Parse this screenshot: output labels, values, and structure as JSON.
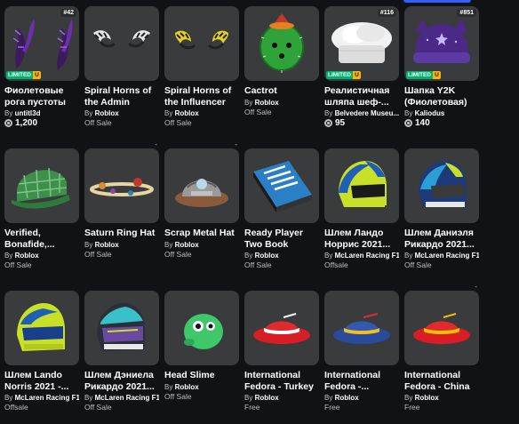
{
  "items": [
    {
      "name": "Фиолетовые рога пустоты",
      "creator_prefix": "By",
      "creator": "untitl3d",
      "price": "1,200",
      "price_type": "robux",
      "serial": "#42",
      "limited": true
    },
    {
      "name": "Spiral Horns of the Admin",
      "creator_prefix": "By",
      "creator": "Roblox",
      "price": "Off Sale",
      "price_type": "text",
      "dash": "-"
    },
    {
      "name": "Spiral Horns of the Influencer",
      "creator_prefix": "By",
      "creator": "Roblox",
      "price": "Off Sale",
      "price_type": "text",
      "dash": "-"
    },
    {
      "name": "Cactrot",
      "creator_prefix": "By",
      "creator": "Roblox",
      "price": "Off Sale",
      "price_type": "text"
    },
    {
      "name": "Реалистичная шляпа шеф-...",
      "creator_prefix": "By",
      "creator": "Belvedere Museu...",
      "price": "95",
      "price_type": "robux",
      "serial": "#116",
      "limited": true
    },
    {
      "name": "Шапка Y2K (Фиолетовая)",
      "creator_prefix": "By",
      "creator": "Kaliodus",
      "price": "140",
      "price_type": "robux",
      "serial": "#851",
      "limited": true
    },
    {
      "name": "Verified, Bonafide,...",
      "creator_prefix": "By",
      "creator": "Roblox",
      "price": "Off Sale",
      "price_type": "text"
    },
    {
      "name": "Saturn Ring Hat",
      "creator_prefix": "By",
      "creator": "Roblox",
      "price": "Off Sale",
      "price_type": "text"
    },
    {
      "name": "Scrap Metal Hat",
      "creator_prefix": "By",
      "creator": "Roblox",
      "price": "Off Sale",
      "price_type": "text"
    },
    {
      "name": "Ready Player Two Book",
      "creator_prefix": "By",
      "creator": "Roblox",
      "price": "Off Sale",
      "price_type": "text"
    },
    {
      "name": "Шлем Ландо Норрис 2021...",
      "creator_prefix": "By",
      "creator": "McLaren Racing F1",
      "price": "Offsale",
      "price_type": "text"
    },
    {
      "name": "Шлем Даниэля Рикардо 2021...",
      "creator_prefix": "By",
      "creator": "McLaren Racing F1",
      "price": "Off Sale",
      "price_type": "text",
      "dash": "-"
    },
    {
      "name": "Шлем Lando Norris 2021 -...",
      "creator_prefix": "By",
      "creator": "McLaren Racing F1",
      "price": "Offsale",
      "price_type": "text"
    },
    {
      "name": "Шлем Дэниела Рикардо 2021...",
      "creator_prefix": "By",
      "creator": "McLaren Racing F1",
      "price": "Off Sale",
      "price_type": "text",
      "dash": "-"
    },
    {
      "name": "Head Slime",
      "creator_prefix": "By",
      "creator": "Roblox",
      "price": "Off Sale",
      "price_type": "text"
    },
    {
      "name": "International Fedora - Turkey",
      "creator_prefix": "By",
      "creator": "Roblox",
      "price": "Free",
      "price_type": "text"
    },
    {
      "name": "International Fedora -...",
      "creator_prefix": "By",
      "creator": "Roblox",
      "price": "Free",
      "price_type": "text"
    },
    {
      "name": "International Fedora - China",
      "creator_prefix": "By",
      "creator": "Roblox",
      "price": "Free",
      "price_type": "text"
    }
  ],
  "badges": {
    "limited_label": "LIMITED",
    "unique_label": "U"
  },
  "colors": {
    "card_bg": "#393b3d",
    "page_bg": "#111216",
    "limited_green": "#00b06f",
    "unique_gold": "#ffb300"
  },
  "icons": [
    "robux-icon"
  ]
}
